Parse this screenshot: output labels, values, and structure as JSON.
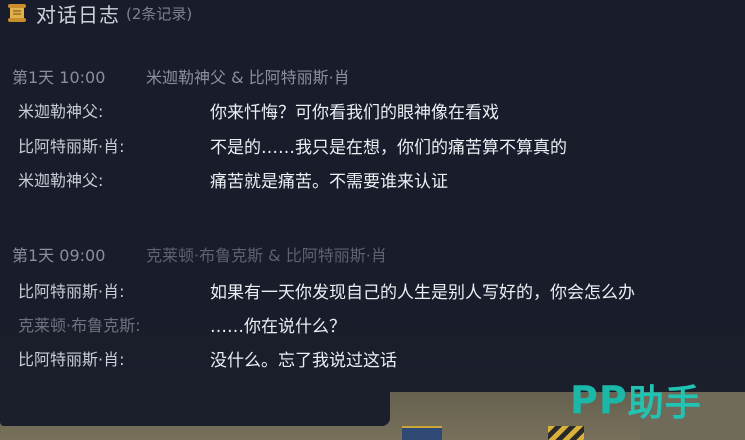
{
  "header": {
    "icon": "scroll-icon",
    "title": "对话日志",
    "count": "(2条记录)"
  },
  "entries": [
    {
      "time": "第1天 10:00",
      "participants": "米迦勒神父 & 比阿特丽斯·肖",
      "lines": [
        {
          "speaker": "米迦勒神父:",
          "text": "你来忏悔？可你看我们的眼神像在看戏"
        },
        {
          "speaker": "比阿特丽斯·肖:",
          "text": "不是的……我只是在想，你们的痛苦算不算真的"
        },
        {
          "speaker": "米迦勒神父:",
          "text": "痛苦就是痛苦。不需要谁来认证"
        }
      ]
    },
    {
      "time": "第1天 09:00",
      "participants": "克莱顿·布鲁克斯 & 比阿特丽斯·肖",
      "lines": [
        {
          "speaker": "比阿特丽斯·肖:",
          "text": "如果有一天你发现自己的人生是别人写好的，你会怎么办"
        },
        {
          "speaker": "克莱顿·布鲁克斯:",
          "text": "……你在说什么？"
        },
        {
          "speaker": "比阿特丽斯·肖:",
          "text": "没什么。忘了我说过这话"
        }
      ]
    }
  ],
  "watermark": {
    "latin": "PP",
    "cn": "助手"
  },
  "colors": {
    "panel": "#181b2a",
    "accent_watermark": "#1bb8a9",
    "speech": "#eceef4",
    "speaker": "#c9ccd6",
    "meta": "#8a8ea0"
  }
}
